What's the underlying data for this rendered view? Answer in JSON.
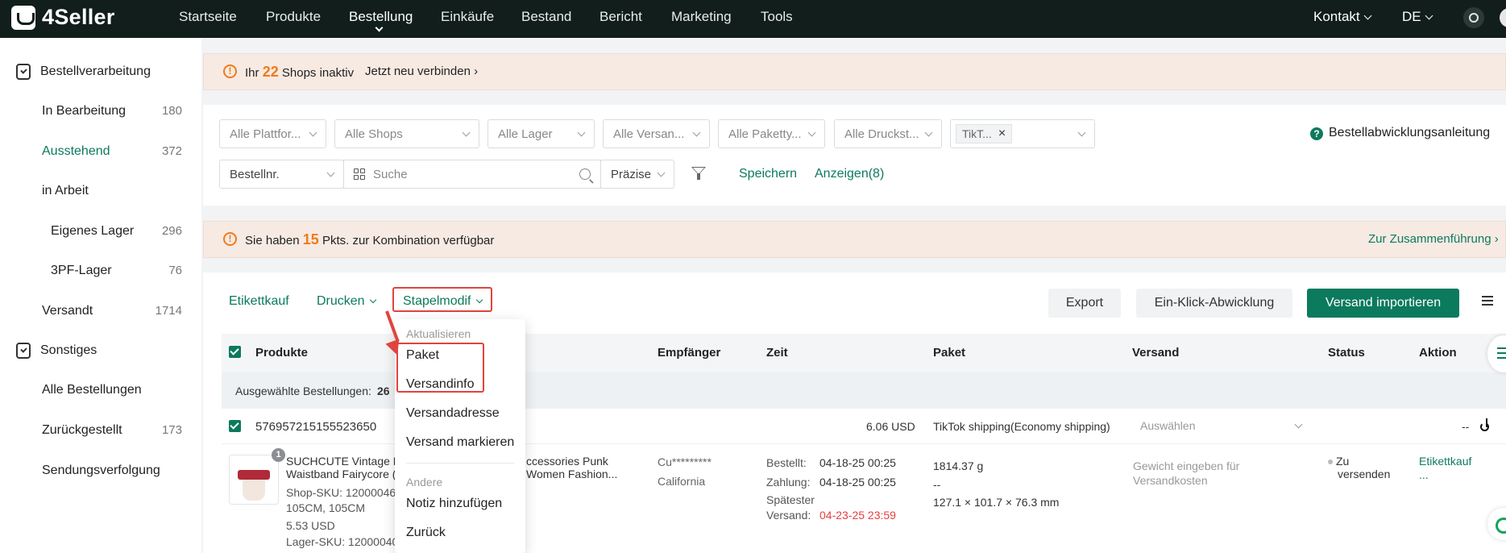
{
  "brand": {
    "logo_text": "4Seller"
  },
  "nav": {
    "items": [
      "Startseite",
      "Produkte",
      "Bestellung",
      "Einkäufe",
      "Bestand",
      "Bericht",
      "Marketing",
      "Tools"
    ],
    "active": "Bestellung",
    "contact": "Kontakt",
    "language": "DE"
  },
  "sidebar": {
    "section1": "Bestellverarbeitung",
    "items": [
      {
        "label": "In Bearbeitung",
        "count": "180"
      },
      {
        "label": "Ausstehend",
        "count": "372"
      },
      {
        "label": "in Arbeit",
        "count": ""
      },
      {
        "label": "Eigenes Lager",
        "count": "296"
      },
      {
        "label": "3PF-Lager",
        "count": "76"
      },
      {
        "label": "Versandt",
        "count": "1714"
      }
    ],
    "section2": "Sonstiges",
    "items2": [
      {
        "label": "Alle Bestellungen",
        "count": ""
      },
      {
        "label": "Zurückgestellt",
        "count": "173"
      },
      {
        "label": "Sendungsverfolgung",
        "count": ""
      }
    ]
  },
  "banner1": {
    "prefix": "Ihr",
    "count": "22",
    "suffix": "Shops inaktiv",
    "link": "Jetzt neu verbinden"
  },
  "filters": {
    "selects": [
      "Alle Plattfor...",
      "Alle Shops",
      "Alle Lager",
      "Alle Versan...",
      "Alle Paketty...",
      "Alle Druckst..."
    ],
    "tag": "TikT...",
    "order_field": "Bestellnr.",
    "search_placeholder": "Suche",
    "precision": "Präzise",
    "save": "Speichern",
    "show": "Anzeigen(8)",
    "guide": "Bestellabwicklungsanleitung"
  },
  "banner2": {
    "prefix": "Sie haben",
    "count": "15",
    "suffix": "Pkts. zur Kombination verfügbar",
    "link": "Zur Zusammenführung"
  },
  "toolbar": {
    "label_buy": "Etikettkauf",
    "print": "Drucken",
    "batch": "Stapelmodif",
    "export": "Export",
    "one_click": "Ein-Klick-Abwicklung",
    "import": "Versand importieren"
  },
  "table": {
    "headers": [
      "Produkte",
      "Empfänger",
      "Zeit",
      "Paket",
      "Versand",
      "Status",
      "Aktion"
    ],
    "selected_label": "Ausgewählte Bestellungen:",
    "selected_count": "26"
  },
  "order": {
    "id": "576957215155523650",
    "total": "6.06 USD",
    "shipping": "TikTok shipping(Economy shipping)",
    "shipping_select": "Auswählen",
    "action_dash": "--",
    "qty": "1",
    "product_title_l1": "SUCHCUTE Vintage F",
    "product_title_l1b": "ccessories Punk",
    "product_title_l2": "Waistband Fairycore (",
    "product_title_l2b": "Women Fashion...",
    "shop_sku": "Shop-SKU: 12000046",
    "size": "105CM, 105CM",
    "price": "5.53 USD",
    "warehouse_sku": "Lager-SKU: 12000040",
    "recipient_name": "Cu*********",
    "recipient_state": "California",
    "ordered_label": "Bestellt:",
    "ordered": "04-18-25 00:25",
    "paid_label": "Zahlung:",
    "paid": "04-18-25 00:25",
    "latest_label_1": "Spätester",
    "latest_label_2": "Versand:",
    "latest": "04-23-25 23:59",
    "weight": "1814.37 g",
    "pkg_dash": "--",
    "dims": "127.1 × 101.7 × 76.3 mm",
    "weight_hint_1": "Gewicht eingeben für",
    "weight_hint_2": "Versandkosten",
    "status_1": "Zu",
    "status_2": "versenden",
    "action_link": "Etikettkauf",
    "action_more": "..."
  },
  "dropdown": {
    "group1": "Aktualisieren",
    "items1": [
      "Paket",
      "Versandinfo",
      "Versandadresse",
      "Versand markieren"
    ],
    "group2": "Andere",
    "items2": [
      "Notiz hinzufügen",
      "Zurück"
    ]
  },
  "colors": {
    "accent": "#0c7a5d",
    "warning": "#ef7b1c",
    "highlight": "#e0443e",
    "topbar": "#111e1b"
  }
}
